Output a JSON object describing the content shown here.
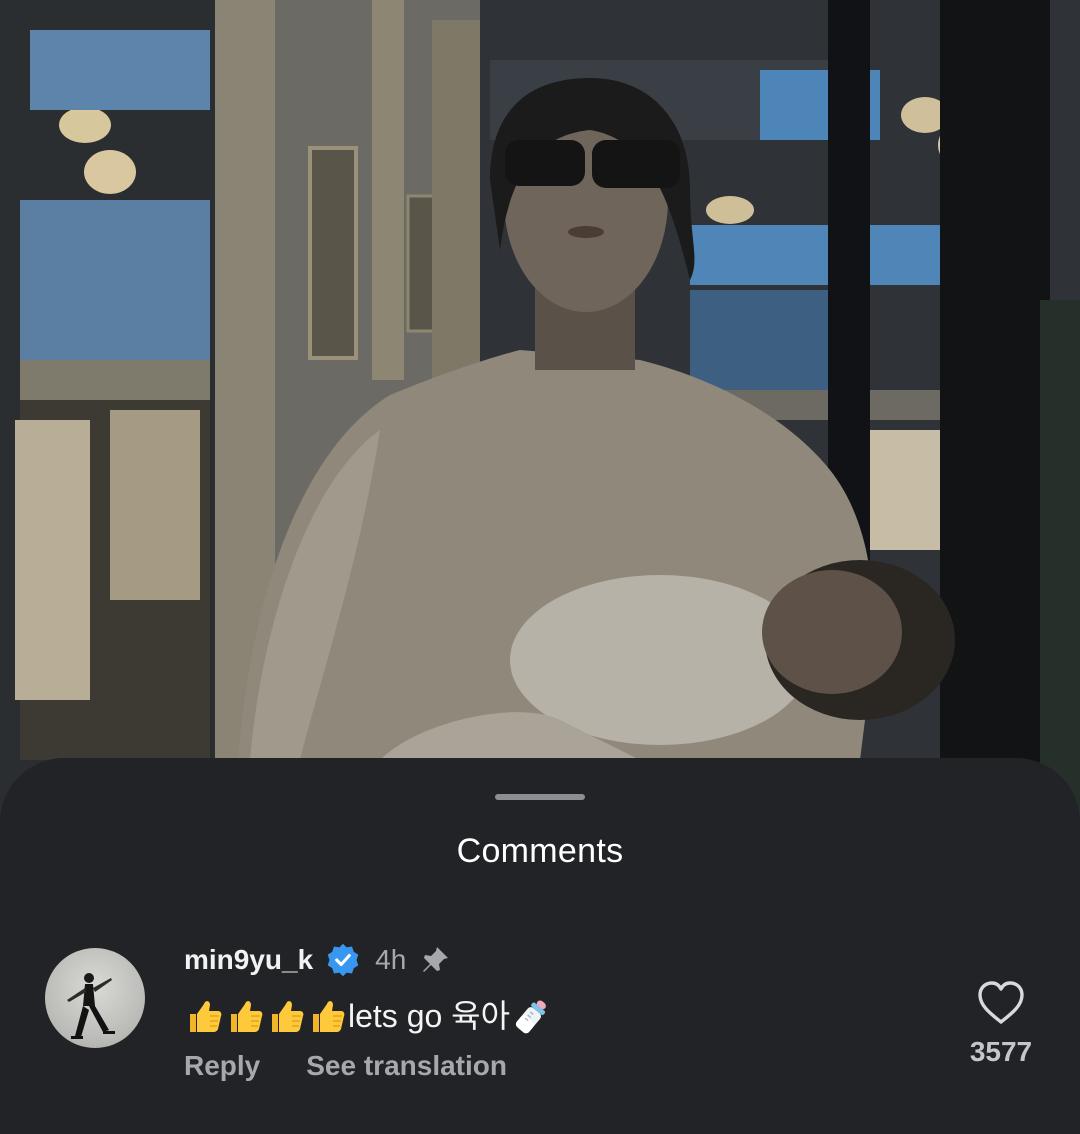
{
  "sheet": {
    "title": "Comments"
  },
  "comment": {
    "username": "min9yu_k",
    "verified_icon": "verified-badge-icon",
    "time": "4h",
    "pinned_icon": "pin-icon",
    "text": "lets go 육아",
    "leading_emoji": "👍👍👍👍",
    "trailing_emoji": "🍼",
    "reply_label": "Reply",
    "translate_label": "See translation",
    "like_count": "3577"
  },
  "colors": {
    "sheet_background": "#222327",
    "accent_verified": "#3897f0",
    "muted_text": "#a7a8ac"
  }
}
